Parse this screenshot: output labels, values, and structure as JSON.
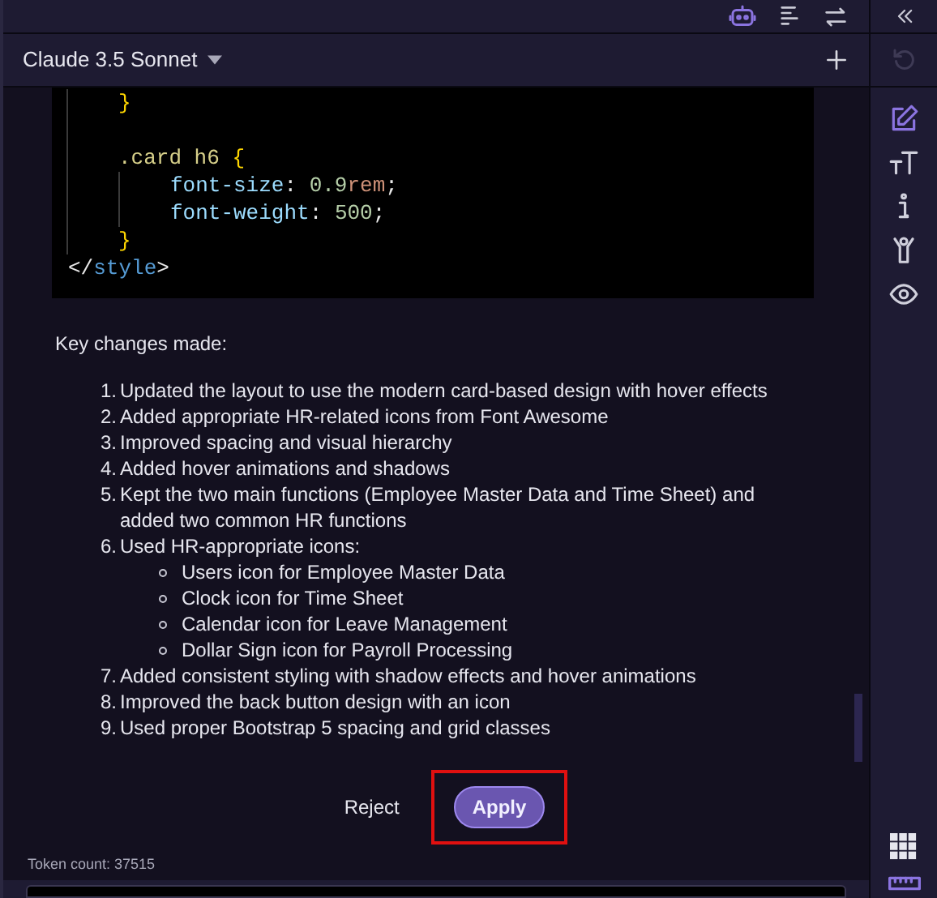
{
  "model_selector": {
    "label": "Claude 3.5 Sonnet"
  },
  "code": [
    {
      "kind": "block",
      "children": [
        {
          "kind": "line",
          "tokens": [
            {
              "text": "}",
              "kind": "brace"
            }
          ]
        },
        {
          "kind": "blank"
        },
        {
          "kind": "line",
          "tokens": [
            {
              "text": ".card h6 ",
              "kind": "selector"
            },
            {
              "text": "{",
              "kind": "brace"
            }
          ],
          "children": [
            {
              "kind": "line",
              "tokens": [
                {
                  "text": "font-size",
                  "kind": "prop"
                },
                {
                  "text": ": ",
                  "kind": "plain"
                },
                {
                  "text": "0.9",
                  "kind": "num"
                },
                {
                  "text": "rem",
                  "kind": "unit"
                },
                {
                  "text": ";",
                  "kind": "plain"
                }
              ]
            },
            {
              "kind": "line",
              "tokens": [
                {
                  "text": "font-weight",
                  "kind": "prop"
                },
                {
                  "text": ": ",
                  "kind": "plain"
                },
                {
                  "text": "500",
                  "kind": "num"
                },
                {
                  "text": ";",
                  "kind": "plain"
                }
              ]
            }
          ]
        },
        {
          "kind": "line",
          "tokens": [
            {
              "text": "}",
              "kind": "brace"
            }
          ]
        }
      ]
    },
    {
      "kind": "line",
      "tokens": [
        {
          "text": "</",
          "kind": "plain"
        },
        {
          "text": "style",
          "kind": "tag"
        },
        {
          "text": ">",
          "kind": "plain"
        }
      ]
    }
  ],
  "heading": "Key changes made:",
  "changes": [
    {
      "number": "1.",
      "text": "Updated the layout to use the modern card-based design with hover effects"
    },
    {
      "number": "2.",
      "text": "Added appropriate HR-related icons from Font Awesome"
    },
    {
      "number": "3.",
      "text": "Improved spacing and visual hierarchy"
    },
    {
      "number": "4.",
      "text": "Added hover animations and shadows"
    },
    {
      "number": "5.",
      "text": "Kept the two main functions (Employee Master Data and Time Sheet) and added two common HR functions"
    },
    {
      "number": "6.",
      "text": "Used HR-appropriate icons:",
      "children": [
        "Users icon for Employee Master Data",
        "Clock icon for Time Sheet",
        "Calendar icon for Leave Management",
        "Dollar Sign icon for Payroll Processing"
      ]
    },
    {
      "number": "7.",
      "text": "Added consistent styling with shadow effects and hover animations"
    },
    {
      "number": "8.",
      "text": "Improved the back button design with an icon"
    },
    {
      "number": "9.",
      "text": "Used proper Bootstrap 5 spacing and grid classes"
    }
  ],
  "actions": {
    "reject": "Reject",
    "apply": "Apply"
  },
  "token_count": "Token count: 37515"
}
